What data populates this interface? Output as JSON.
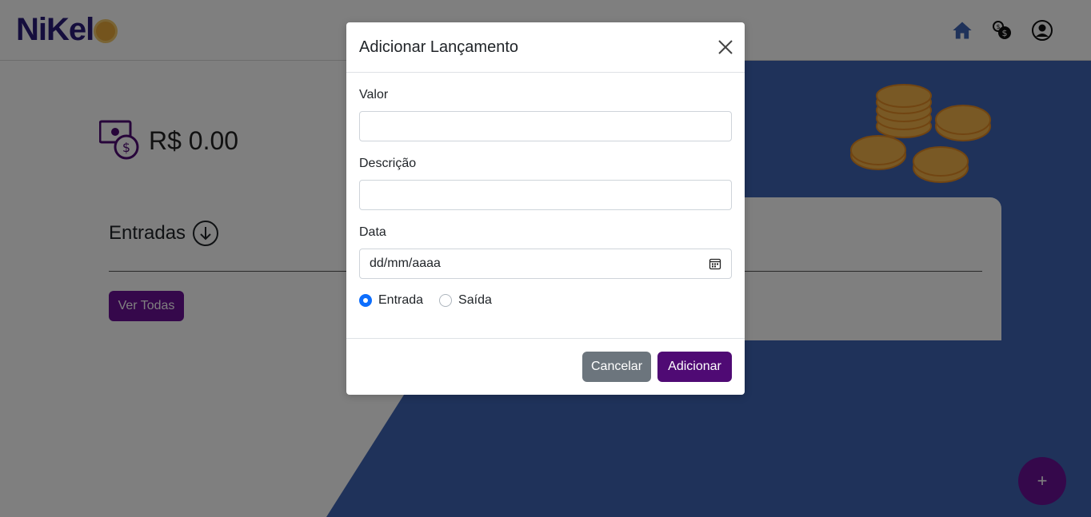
{
  "app": {
    "logo_text": "NiKel"
  },
  "header": {
    "icons": [
      "home-icon",
      "transactions-icon",
      "user-profile-icon"
    ]
  },
  "balance": {
    "value": "R$ 0.00",
    "icon": "money-icon"
  },
  "card": {
    "title": "Entradas",
    "title_icon": "arrow-down-circle-icon",
    "button_label": "Ver Todas"
  },
  "fab": {
    "label": "+"
  },
  "modal": {
    "title": "Adicionar Lançamento",
    "fields": {
      "valor_label": "Valor",
      "valor_value": "",
      "descricao_label": "Descrição",
      "descricao_value": "",
      "data_label": "Data",
      "data_placeholder": "dd/mm/aaaa"
    },
    "radio": {
      "entrada_label": "Entrada",
      "saida_label": "Saída",
      "selected": "Entrada"
    },
    "buttons": {
      "cancel_label": "Cancelar",
      "add_label": "Adicionar"
    }
  },
  "colors": {
    "brand_purple": "#6a1196",
    "add_button": "#4f0a74",
    "cancel_button": "#6c757d",
    "background_blue": "#3f64b4",
    "radio_checked": "#0d6efd"
  }
}
